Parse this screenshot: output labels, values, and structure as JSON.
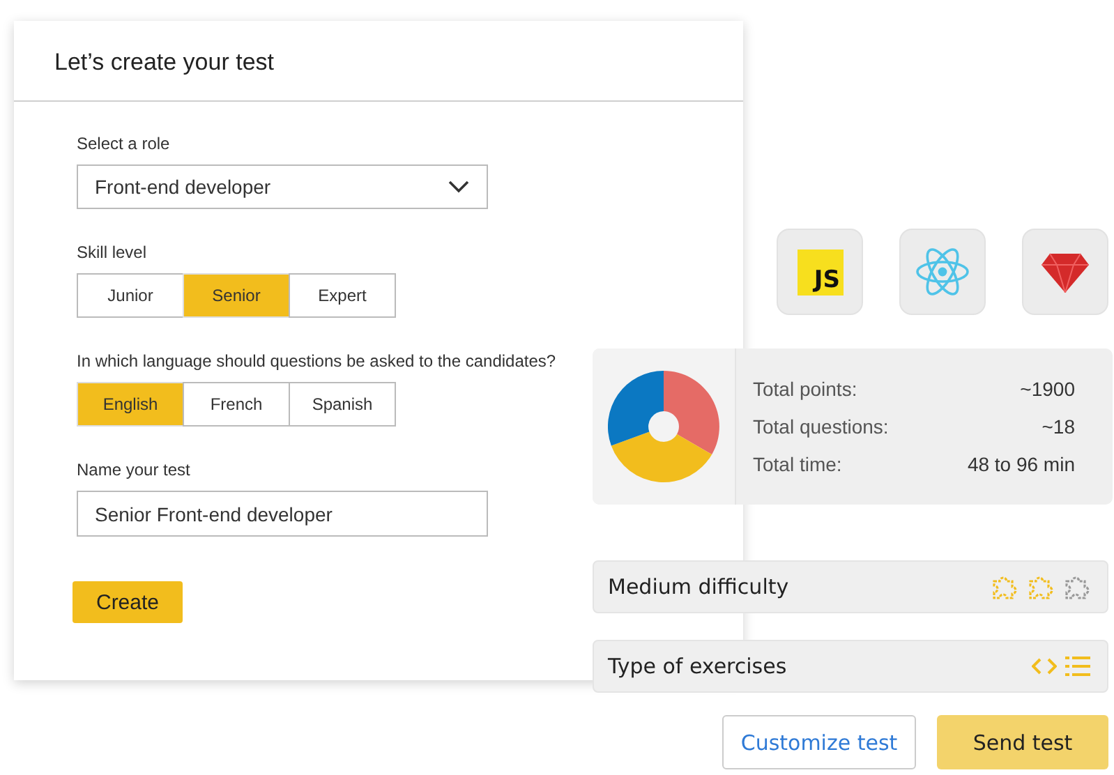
{
  "form": {
    "title": "Let’s create your test",
    "role": {
      "label": "Select a role",
      "value": "Front-end developer"
    },
    "skill": {
      "label": "Skill level",
      "options": [
        {
          "label": "Junior",
          "selected": false
        },
        {
          "label": "Senior",
          "selected": true
        },
        {
          "label": "Expert",
          "selected": false
        }
      ]
    },
    "language": {
      "label": "In which language should questions be asked to the candidates?",
      "options": [
        {
          "label": "English",
          "selected": true
        },
        {
          "label": "French",
          "selected": false
        },
        {
          "label": "Spanish",
          "selected": false
        }
      ]
    },
    "name": {
      "label": "Name your test",
      "value": "Senior Front-end developer"
    },
    "create_button": "Create"
  },
  "tech_icons": [
    {
      "kind": "js",
      "label": "JS"
    },
    {
      "kind": "react"
    },
    {
      "kind": "ruby"
    }
  ],
  "summary": {
    "stats": [
      {
        "label": "Total points:",
        "value": "~1900"
      },
      {
        "label": "Total questions:",
        "value": "~18"
      },
      {
        "label": "Total time:",
        "value": "48 to 96 min"
      }
    ]
  },
  "difficulty": {
    "label": "Medium difficulty",
    "pieces": [
      {
        "on": true
      },
      {
        "on": true
      },
      {
        "on": false
      }
    ]
  },
  "exercises": {
    "label": "Type of exercises"
  },
  "buttons": {
    "customize": "Customize test",
    "send": "Send test"
  }
}
